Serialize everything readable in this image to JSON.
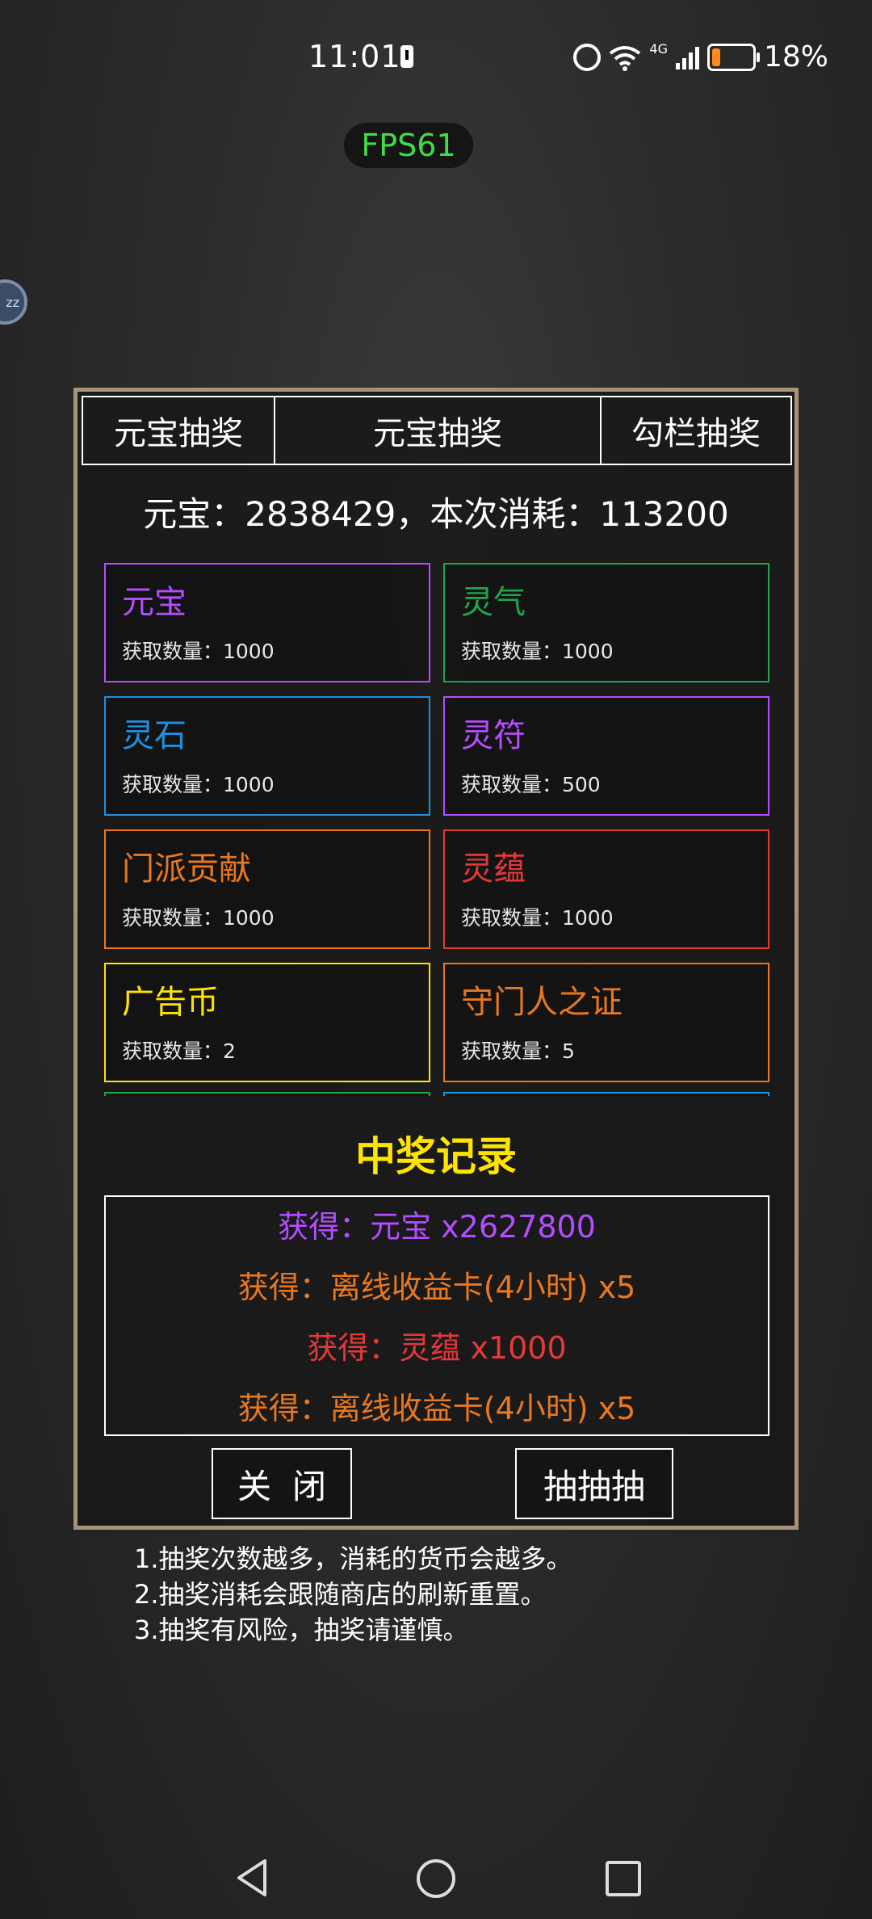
{
  "status_bar": {
    "time": "11:01",
    "network": "4G",
    "battery_pct": "18%"
  },
  "fps": "FPS61",
  "float_ball": {
    "label": "zz"
  },
  "tabs": [
    "元宝抽奖",
    "元宝抽奖",
    "勾栏抽奖"
  ],
  "currency_line": "元宝：2838429，本次消耗：113200",
  "prizes": [
    {
      "name": "元宝",
      "qty": "获取数量：1000",
      "color": "#b44dff"
    },
    {
      "name": "灵气",
      "qty": "获取数量：1000",
      "color": "#1fa64a"
    },
    {
      "name": "灵石",
      "qty": "获取数量：1000",
      "color": "#1f8fe0"
    },
    {
      "name": "灵符",
      "qty": "获取数量：500",
      "color": "#b44dff"
    },
    {
      "name": "门派贡献",
      "qty": "获取数量：1000",
      "color": "#e9781e"
    },
    {
      "name": "灵蕴",
      "qty": "获取数量：1000",
      "color": "#e53838"
    },
    {
      "name": "广告币",
      "qty": "获取数量：2",
      "color": "#ffe400"
    },
    {
      "name": "守门人之证",
      "qty": "获取数量：5",
      "color": "#e9781e"
    }
  ],
  "partial_cards": [
    {
      "color": "#1fa64a"
    },
    {
      "color": "#1f8fe0"
    }
  ],
  "records_title": "中奖记录",
  "records": [
    {
      "text": "获得：元宝 x2627800",
      "color": "#b44dff"
    },
    {
      "text": "获得：离线收益卡(4小时) x5",
      "color": "#e9781e"
    },
    {
      "text": "获得：灵蕴 x1000",
      "color": "#e53838"
    },
    {
      "text": "获得：离线收益卡(4小时) x5",
      "color": "#e9781e"
    }
  ],
  "buttons": {
    "close": "关闭",
    "draw": "抽抽抽"
  },
  "notes": [
    "1.抽奖次数越多，消耗的货币会越多。",
    "2.抽奖消耗会跟随商店的刷新重置。",
    "3.抽奖有风险，抽奖请谨慎。"
  ]
}
